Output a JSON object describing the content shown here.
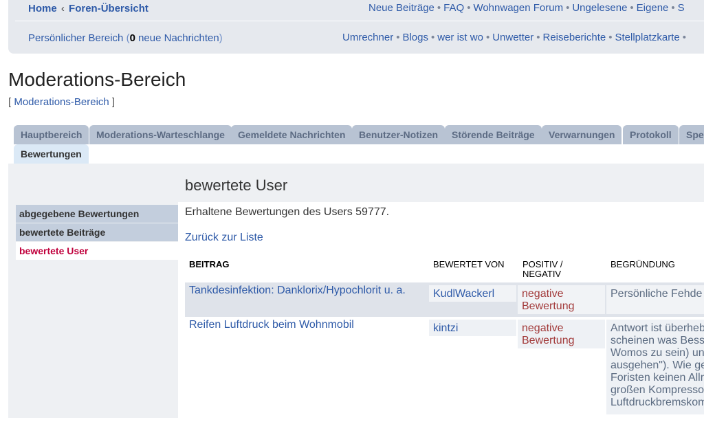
{
  "header": {
    "breadcrumb_home": "Home",
    "breadcrumb_sep": "‹",
    "breadcrumb_forums": "Foren-Übersicht",
    "nav_row1": [
      "Neue Beiträge",
      "FAQ",
      "Wohnwagen Forum",
      "Ungelesene",
      "Eigene",
      "S"
    ],
    "nav_row2": [
      "Umrechner",
      "Blogs",
      "wer ist wo",
      "Unwetter",
      "Reiseberichte",
      "Stellplatzkarte"
    ],
    "personal_label": "Persönlicher Bereich",
    "paren_open": "(",
    "new_count": "0",
    "new_messages": "neue Nachrichten",
    "paren_close": ")"
  },
  "page": {
    "title": "Moderations-Bereich",
    "bracket_open": "[",
    "crumb_link": "Moderations-Bereich",
    "bracket_close": "]"
  },
  "tabs": [
    "Hauptbereich",
    "Moderations-Warteschlange",
    "Gemeldete Nachrichten",
    "Benutzer-Notizen",
    "Störende Beiträge",
    "Verwarnungen",
    "Protokoll",
    "Spe",
    "Bewertungen"
  ],
  "sidebar": {
    "items": [
      "abgegebene Bewertungen",
      "bewertete Beiträge",
      "bewertete User"
    ]
  },
  "content": {
    "title": "bewertete User",
    "intro": "Erhaltene Bewertungen des Users 59777.",
    "back_link": "Zurück zur Liste"
  },
  "table": {
    "headers": [
      "Beitrag",
      "Bewertet von",
      "Positiv / Negativ",
      "Begründung"
    ],
    "rows": [
      {
        "post": "Tankdesinfektion: Danklorix/Hypochlorit u. a.",
        "rated_by": "KudlWackerl",
        "rating_line1": "negative",
        "rating_line2": "Bewertung",
        "reason_lines": [
          "Persönliche Fehde"
        ]
      },
      {
        "post": "Reifen Luftdruck beim Wohnmobil",
        "rated_by": "kintzi",
        "rating_line1": "negative",
        "rating_line2": "Bewertung",
        "reason_lines": [
          "Antwort ist überheb",
          "scheinen was Besse",
          "Womos zu sein) und",
          "ausgehen\"). Wie ge",
          "Foristen keinen Allr",
          "großen Kompressor",
          "Luftdruckbremskom"
        ]
      }
    ]
  }
}
